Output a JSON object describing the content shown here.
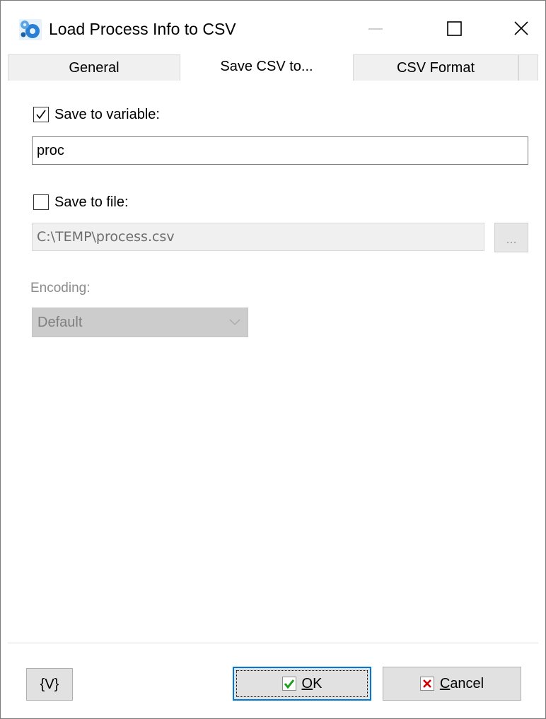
{
  "window": {
    "title": "Load Process Info to CSV",
    "app_icon": "gears-icon"
  },
  "tabs": [
    {
      "label": "General",
      "active": false
    },
    {
      "label": "Save CSV to...",
      "active": true
    },
    {
      "label": "CSV Format",
      "active": false
    }
  ],
  "save_to_variable": {
    "label": "Save to variable:",
    "checked": true,
    "value": "proc"
  },
  "save_to_file": {
    "label": "Save to file:",
    "checked": false,
    "value": "C:\\TEMP\\process.csv",
    "browse_label": "..."
  },
  "encoding": {
    "label": "Encoding:",
    "selected": "Default"
  },
  "buttons": {
    "variables_label": "{V}",
    "ok_label": "OK",
    "cancel_label": "Cancel"
  },
  "colors": {
    "focus_border": "#0078d7",
    "ok_check": "#1e9e1e",
    "cancel_x": "#d40000",
    "app_icon_blue": "#2a7fd4"
  }
}
